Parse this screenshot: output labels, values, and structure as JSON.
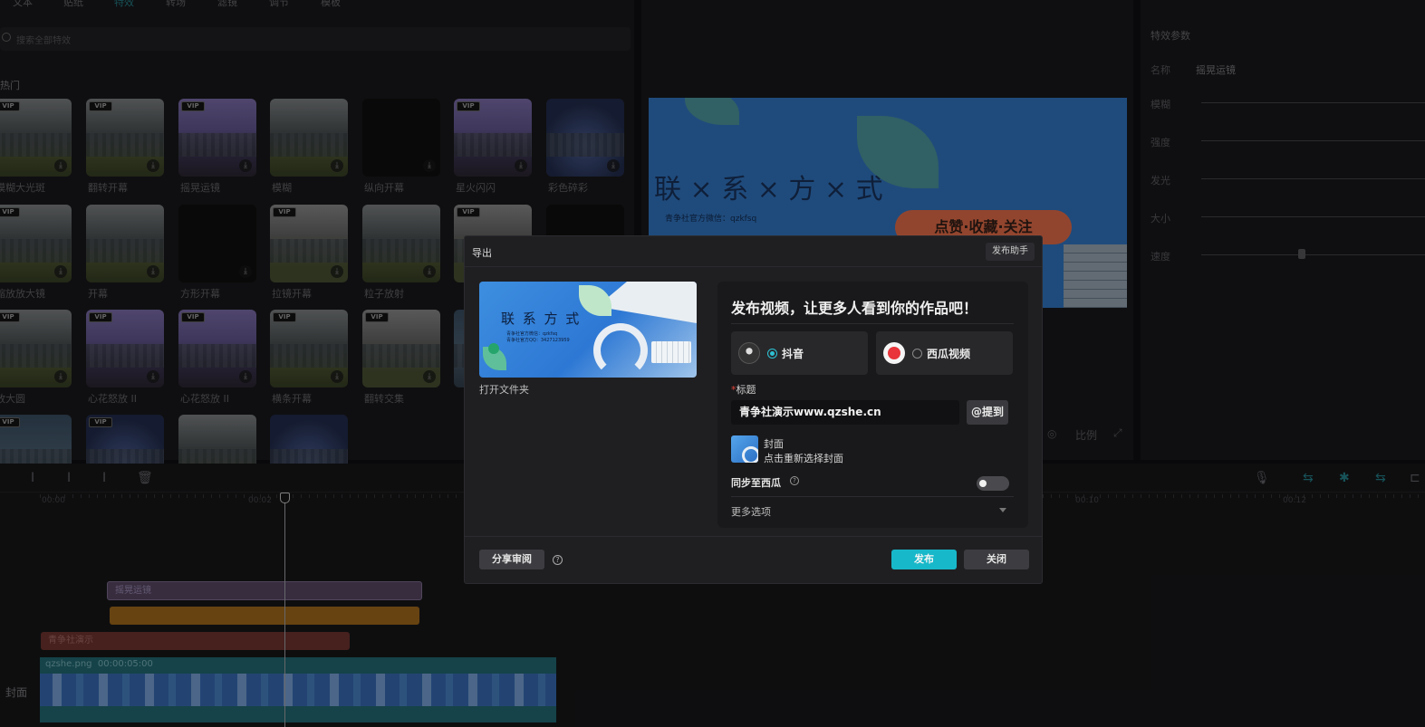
{
  "top_tabs": [
    {
      "label": "文本",
      "active": false
    },
    {
      "label": "贴纸",
      "active": false
    },
    {
      "label": "特效",
      "active": true
    },
    {
      "label": "转场",
      "active": false
    },
    {
      "label": "滤镜",
      "active": false
    },
    {
      "label": "调节",
      "active": false
    },
    {
      "label": "模板",
      "active": false
    }
  ],
  "effects_panel": {
    "search_placeholder": "搜索全部特效",
    "section_title": "热门",
    "items": [
      {
        "label": "模糊大光斑",
        "vip": true,
        "style": "fog"
      },
      {
        "label": "翻转开幕",
        "vip": true,
        "style": "fog"
      },
      {
        "label": "摇晃运镜",
        "vip": true,
        "style": "purple"
      },
      {
        "label": "模糊",
        "vip": false,
        "style": "fog"
      },
      {
        "label": "纵向开幕",
        "vip": false,
        "style": "dark"
      },
      {
        "label": "星火闪闪",
        "vip": true,
        "style": "purple"
      },
      {
        "label": "彩色碎彩",
        "vip": false,
        "style": "night"
      },
      {
        "label": "缩放放大镜",
        "vip": true,
        "style": "fog"
      },
      {
        "label": "开幕",
        "vip": false,
        "style": "fog"
      },
      {
        "label": "方形开幕",
        "vip": false,
        "style": "dark"
      },
      {
        "label": "拉镜开幕",
        "vip": true,
        "style": "light"
      },
      {
        "label": "粒子放射",
        "vip": false,
        "style": "fog"
      },
      {
        "label": "",
        "vip": true,
        "style": "light"
      },
      {
        "label": "",
        "vip": false,
        "style": "dark"
      },
      {
        "label": "放大圆",
        "vip": true,
        "style": "fog"
      },
      {
        "label": "心花怒放 II",
        "vip": true,
        "style": "purple"
      },
      {
        "label": "心花怒放 II",
        "vip": true,
        "style": "purple"
      },
      {
        "label": "横条开幕",
        "vip": true,
        "style": "fog"
      },
      {
        "label": "翻转交集",
        "vip": true,
        "style": "light"
      },
      {
        "label": "",
        "vip": false,
        "style": "sky"
      },
      {
        "label": "",
        "vip": false,
        "style": "sky"
      },
      {
        "label": "",
        "vip": true,
        "style": "sky"
      },
      {
        "label": "",
        "vip": true,
        "style": "night"
      },
      {
        "label": "",
        "vip": false,
        "style": "fog"
      },
      {
        "label": "",
        "vip": false,
        "style": "night"
      }
    ]
  },
  "preview": {
    "big_text": "联 × 系 × 方 × 式",
    "wechat_line": "青争社官方微信：qzkfsq",
    "badge": "点赞·收藏·关注",
    "tools": [
      "比例"
    ]
  },
  "params_panel": {
    "title": "特效参数",
    "name_label": "名称",
    "name_value": "摇晃运镜",
    "sliders": [
      {
        "label": "模糊"
      },
      {
        "label": "强度"
      },
      {
        "label": "发光"
      },
      {
        "label": "大小"
      },
      {
        "label": "速度",
        "value": 0.45
      }
    ]
  },
  "timeline": {
    "ruler_labels": [
      "00:00",
      "00:02",
      "00:10",
      "00:12"
    ],
    "clips": {
      "effect": "摇晃运镜",
      "text": "青争社演示",
      "video_name": "qzshe.png",
      "video_duration": "00:00:05:00"
    },
    "cover_label": "封面"
  },
  "dialog": {
    "title": "导出",
    "assistant_button": "发布助手",
    "open_folder": "打开文件夹",
    "cover_thumb_text": "联 系 方 式",
    "cover_thumb_lines": [
      "青争社官方微信：qzkfsq",
      "青争社官方QQ：3427123959"
    ],
    "headline": "发布视频，让更多人看到你的作品吧！",
    "platforms": [
      {
        "name": "抖音",
        "selected": true
      },
      {
        "name": "西瓜视频",
        "selected": false
      }
    ],
    "title_label": "标题",
    "title_required_mark": "*",
    "title_value": "青争社演示www.qzshe.cn",
    "mention_button": "@提到",
    "cover_title": "封面",
    "cover_sub": "点击重新选择封面",
    "sync_label": "同步至西瓜",
    "sync_enabled": false,
    "more_options": "更多选项",
    "share_button": "分享审阅",
    "publish_button": "发布",
    "close_button": "关闭",
    "accent_color": "#17b8c9"
  }
}
